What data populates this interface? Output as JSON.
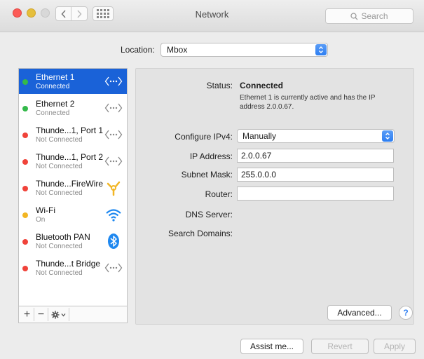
{
  "window": {
    "title": "Network"
  },
  "toolbar": {
    "search_placeholder": "Search"
  },
  "location": {
    "label": "Location:",
    "value": "Mbox"
  },
  "services": [
    {
      "name": "Ethernet 1",
      "status": "Connected",
      "color": "green",
      "icon": "ethernet-icon",
      "selected": true
    },
    {
      "name": "Ethernet 2",
      "status": "Connected",
      "color": "green",
      "icon": "ethernet-icon"
    },
    {
      "name": "Thunde...1, Port 1",
      "status": "Not Connected",
      "color": "red",
      "icon": "ethernet-icon"
    },
    {
      "name": "Thunde...1, Port 2",
      "status": "Not Connected",
      "color": "red",
      "icon": "ethernet-icon"
    },
    {
      "name": "Thunde...FireWire",
      "status": "Not Connected",
      "color": "red",
      "icon": "firewire-icon"
    },
    {
      "name": "Wi-Fi",
      "status": "On",
      "color": "yellow",
      "icon": "wifi-icon"
    },
    {
      "name": "Bluetooth PAN",
      "status": "Not Connected",
      "color": "red",
      "icon": "bluetooth-icon"
    },
    {
      "name": "Thunde...t Bridge",
      "status": "Not Connected",
      "color": "red",
      "icon": "ethernet-icon"
    }
  ],
  "sidebar_footer": {
    "add": "+",
    "remove": "−"
  },
  "detail": {
    "status_label": "Status:",
    "status_value": "Connected",
    "status_desc": "Ethernet 1 is currently active and has the IP address 2.0.0.67.",
    "configure_label": "Configure IPv4:",
    "configure_value": "Manually",
    "ip_label": "IP Address:",
    "ip_value": "2.0.0.67",
    "subnet_label": "Subnet Mask:",
    "subnet_value": "255.0.0.0",
    "router_label": "Router:",
    "router_value": "",
    "dns_label": "DNS Server:",
    "search_domains_label": "Search Domains:",
    "advanced_label": "Advanced...",
    "help_label": "?"
  },
  "bottom": {
    "assist": "Assist me...",
    "revert": "Revert",
    "apply": "Apply"
  },
  "colors": {
    "accent": "#1a62d8",
    "green": "#34b94a",
    "red": "#f0433a",
    "yellow": "#f2b624"
  }
}
